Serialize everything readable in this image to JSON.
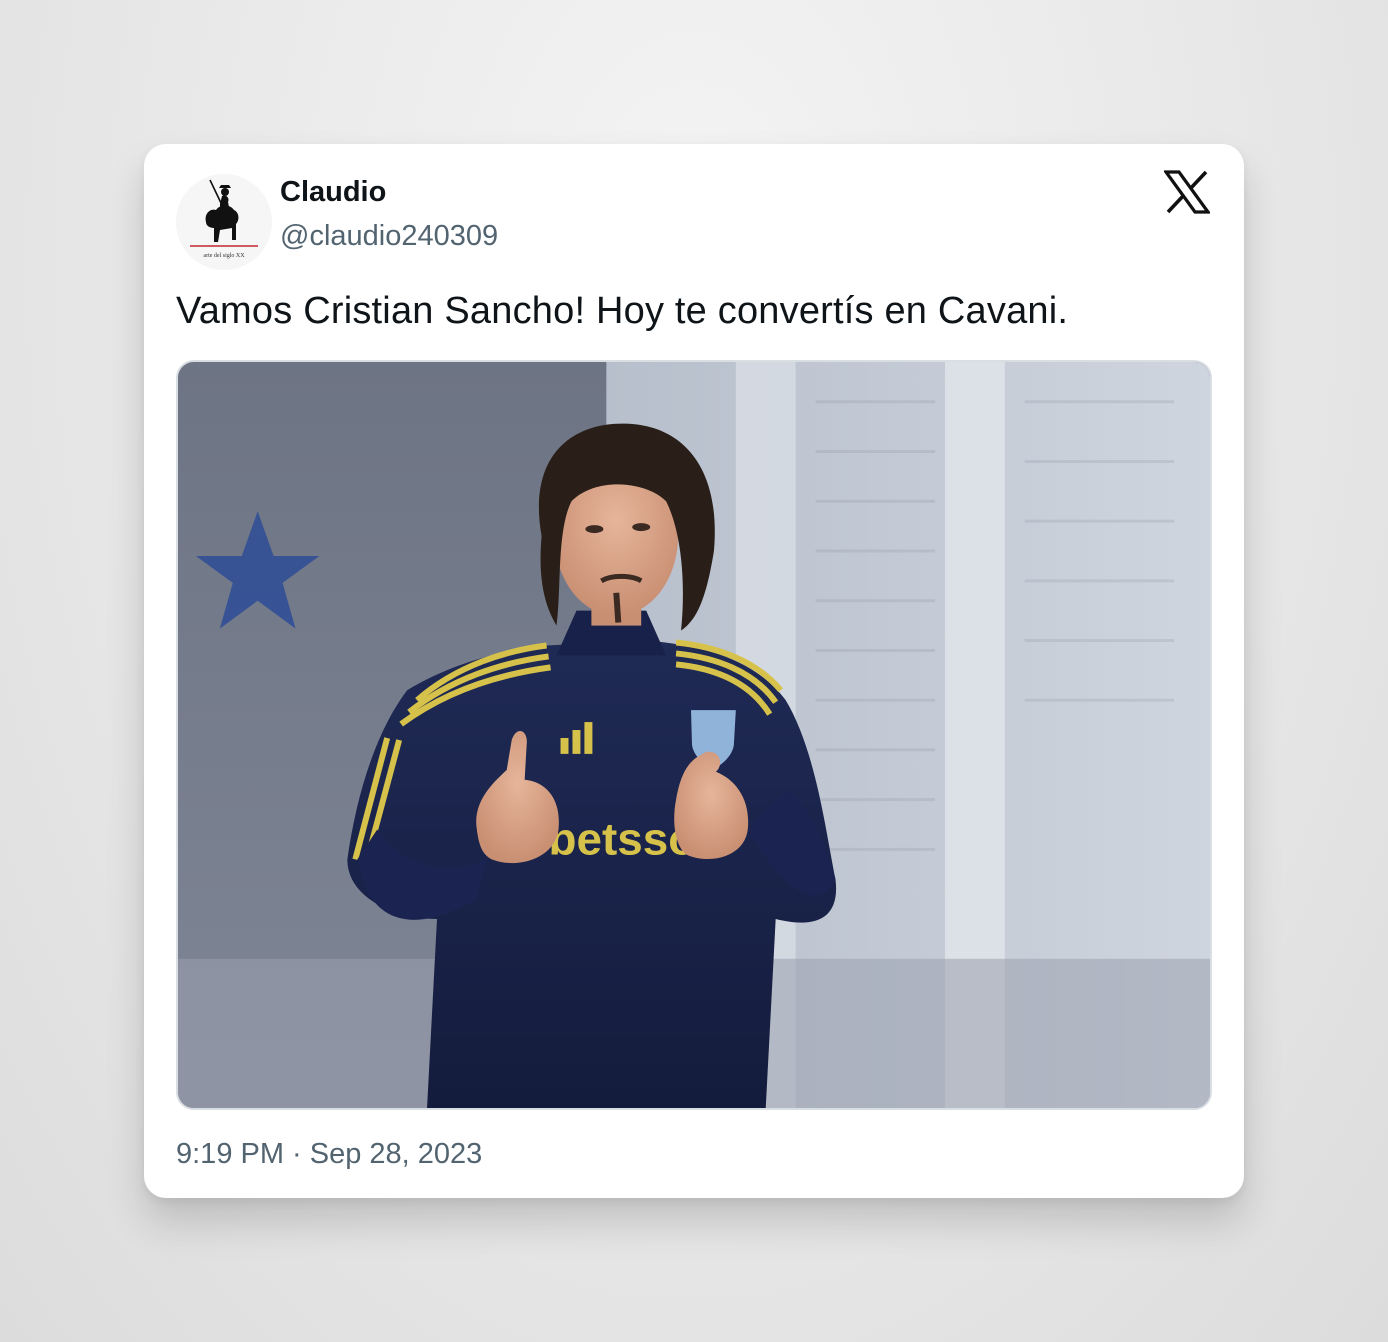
{
  "author": {
    "display_name": "Claudio",
    "handle": "@claudio240309",
    "avatar_caption": "arte del siglo XX"
  },
  "tweet": {
    "text": "Vamos Cristian Sancho! Hoy te convertís en Cavani.",
    "timestamp": "9:19 PM · Sep 28, 2023"
  },
  "media": {
    "shirt_text": "betsson"
  },
  "icons": {
    "platform": "x-logo-icon"
  }
}
